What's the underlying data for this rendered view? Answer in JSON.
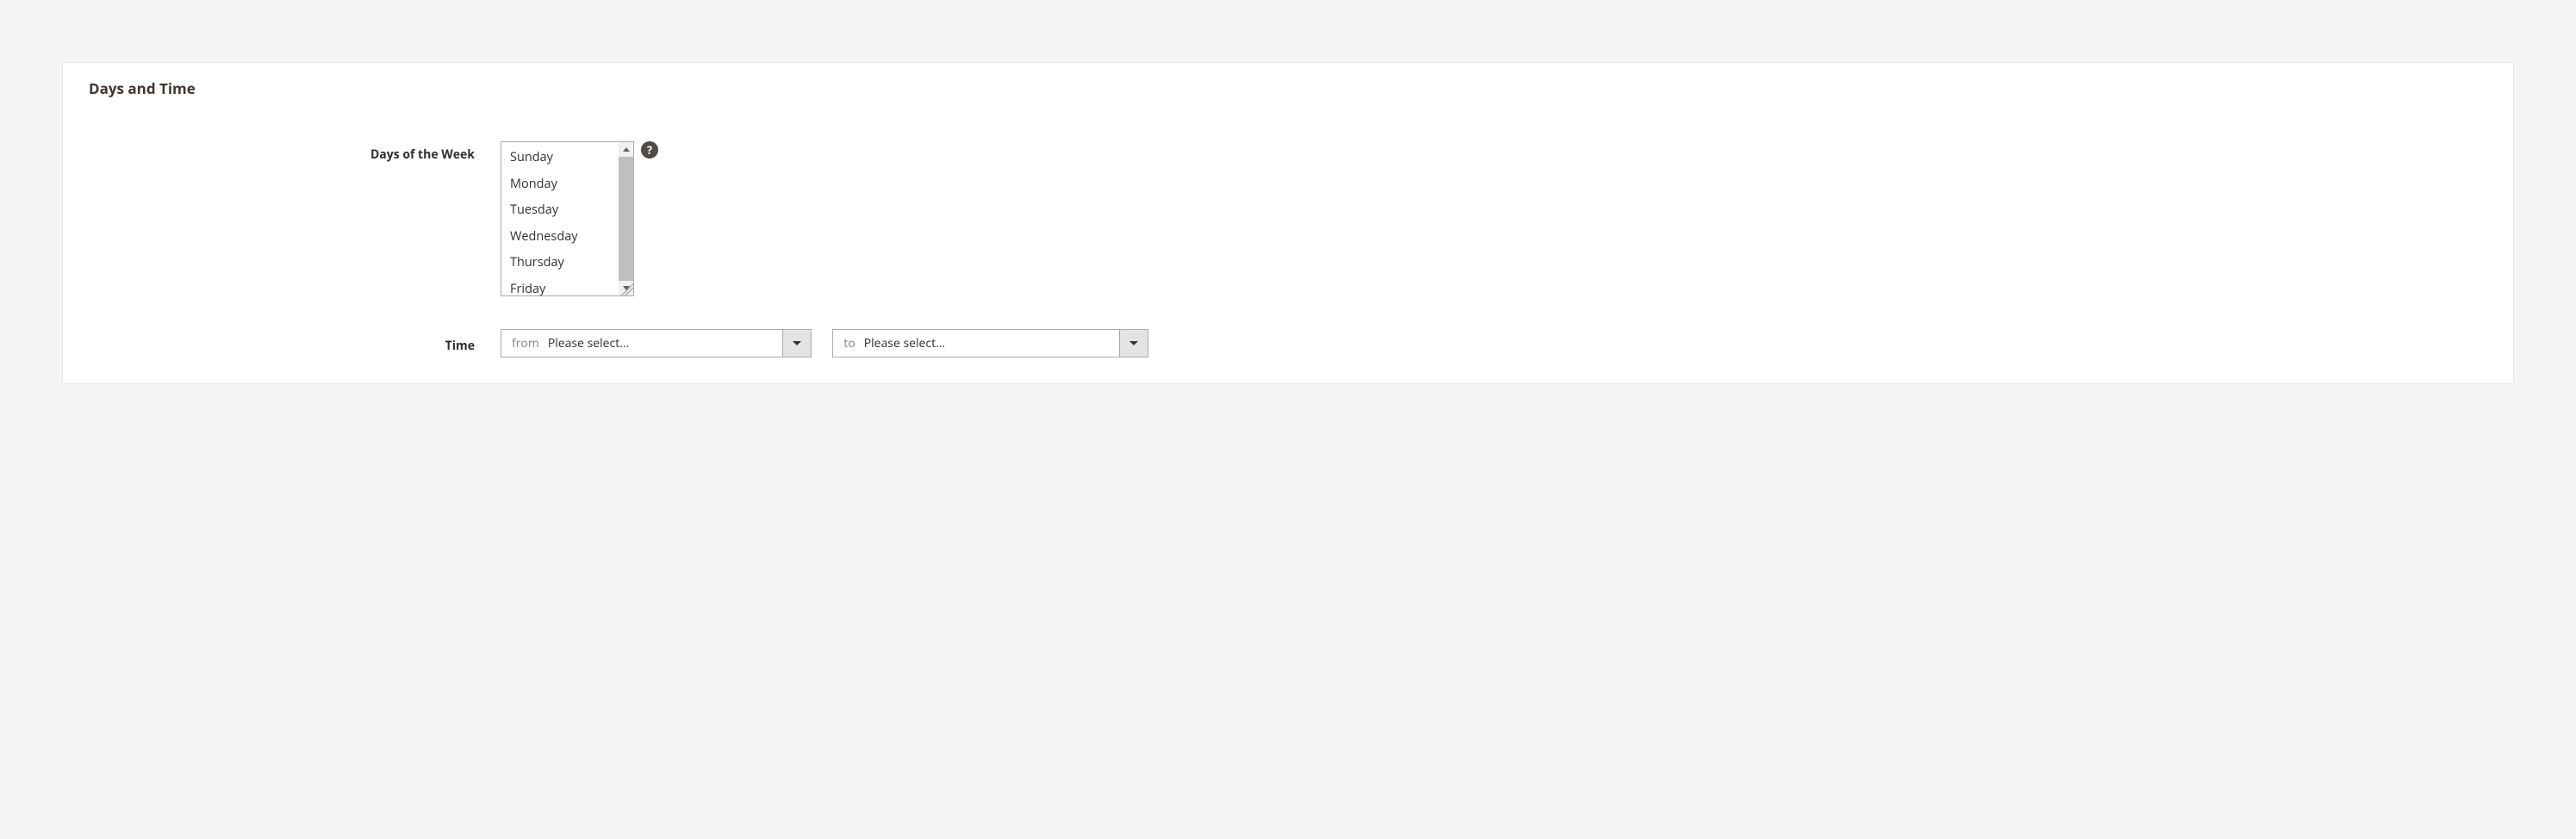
{
  "section": {
    "title": "Days and Time"
  },
  "days": {
    "label": "Days of the Week",
    "options": [
      "Sunday",
      "Monday",
      "Tuesday",
      "Wednesday",
      "Thursday",
      "Friday"
    ],
    "help_glyph": "?"
  },
  "time": {
    "label": "Time",
    "from": {
      "prefix": "from",
      "value": "Please select..."
    },
    "to": {
      "prefix": "to",
      "value": "Please select..."
    }
  }
}
